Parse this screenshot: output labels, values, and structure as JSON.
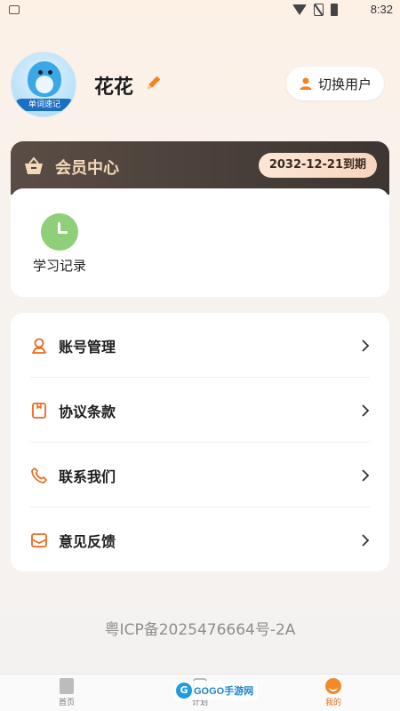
{
  "status_bar": {
    "time": "8:32"
  },
  "profile": {
    "avatar_caption": "单词速记",
    "username": "花花",
    "switch_user_label": "切换用户"
  },
  "vip": {
    "title": "会员中心",
    "expire_text": "2032-12-21到期"
  },
  "records": {
    "items": [
      {
        "label": "学习记录",
        "icon": "clock-icon"
      }
    ]
  },
  "menu": {
    "items": [
      {
        "label": "账号管理",
        "icon": "user-icon"
      },
      {
        "label": "协议条款",
        "icon": "document-icon"
      },
      {
        "label": "联系我们",
        "icon": "phone-icon"
      },
      {
        "label": "意见反馈",
        "icon": "mail-icon"
      }
    ]
  },
  "footer": {
    "icp": "粤ICP备2025476664号-2A"
  },
  "tabbar": {
    "tabs": [
      {
        "label": "首页"
      },
      {
        "label": "计划"
      },
      {
        "label": "我的"
      }
    ],
    "active_index": 2
  },
  "watermark": {
    "text": "GOGO手游网"
  },
  "colors": {
    "accent": "#e96a1c",
    "vip_bg": "#4a403b",
    "vip_text": "#f4d9b9"
  }
}
